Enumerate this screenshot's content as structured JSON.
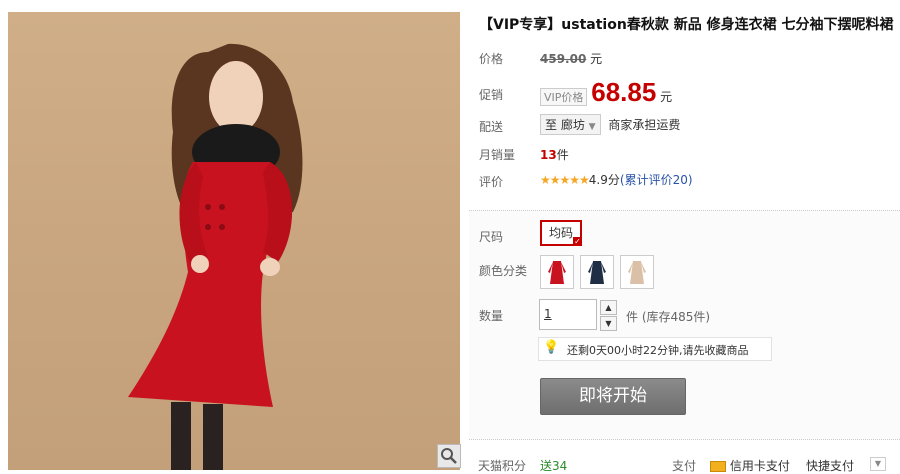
{
  "product": {
    "title": "【VIP专享】ustation春秋款 新品 修身连衣裙 七分袖下摆呢料裙"
  },
  "info": {
    "original_price_label": "价格",
    "original_price": "459.00",
    "original_price_unit": "元",
    "promo_label": "促销",
    "vip_tag": "VIP价格",
    "promo_price": "68.85",
    "promo_unit": "元",
    "shipping_label": "配送",
    "shipping_dest": "至 廊坊",
    "shipping_note": "商家承担运费",
    "monthly_sales_label": "月销量",
    "monthly_sales_count": "13",
    "monthly_sales_unit": "件",
    "rating_label": "评价",
    "rating_stars": "★★★★★",
    "rating_score": "4.9分",
    "rating_link": "(累计评价20)"
  },
  "options": {
    "size_label": "尺码",
    "size_value": "均码",
    "color_label": "颜色分类",
    "quantity_label": "数量",
    "quantity_value": "1",
    "quantity_unit": "件",
    "stock_text": "(库存485件)",
    "countdown_text": "还剩0天00小时22分钟,请先收藏商品",
    "action_button": "即将开始",
    "colors": [
      "#c8121f",
      "#1f2d45",
      "#d9c0a6"
    ]
  },
  "footer": {
    "points_label": "天猫积分",
    "points_value": "送34",
    "pay_label": "支付",
    "credit_card": "信用卡支付",
    "quick_pay": "快捷支付"
  }
}
